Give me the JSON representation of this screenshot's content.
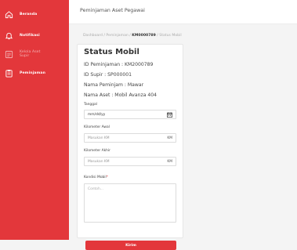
{
  "sidebar": {
    "items": [
      {
        "label": "Beranda",
        "icon": "home-icon"
      },
      {
        "label": "Notifikasi",
        "icon": "bell-icon"
      },
      {
        "label": "Kelola Aset\nSupir",
        "icon": "list-icon"
      },
      {
        "label": "Peminjaman",
        "icon": "clipboard-icon"
      }
    ]
  },
  "header": {
    "title": "Peminjaman Aset Pegawai"
  },
  "breadcrumb": {
    "first": "Dashboard",
    "second": "Peminjaman",
    "current": "KM0000789",
    "last": "Status Mobil"
  },
  "card": {
    "title": "Status Mobil",
    "id_peminjaman": "ID Peminjaman : KM2000789",
    "id_supir": "ID Supir : SP000001",
    "nama_peminjam": "Nama Peminjam : Mawar",
    "nama_aset": "Nama Aset : Mobil Avanza 404"
  },
  "form": {
    "tanggal_label": "Tanggal",
    "tanggal_value": "mm/dd/yy",
    "km_awal_label": "Kilometer Awal",
    "km_awal_placeholder": "Masukan KM",
    "km_awal_unit": "KM",
    "km_akhir_label": "Kilometer Akhir",
    "km_akhir_placeholder": "Masukan KM",
    "km_akhir_unit": "KM",
    "kondisi_label": "Kondisi Mobil",
    "kondisi_required": "*",
    "kondisi_placeholder": "Contoh...",
    "submit_label": "Kirim"
  },
  "colors": {
    "accent": "#e3373b"
  }
}
